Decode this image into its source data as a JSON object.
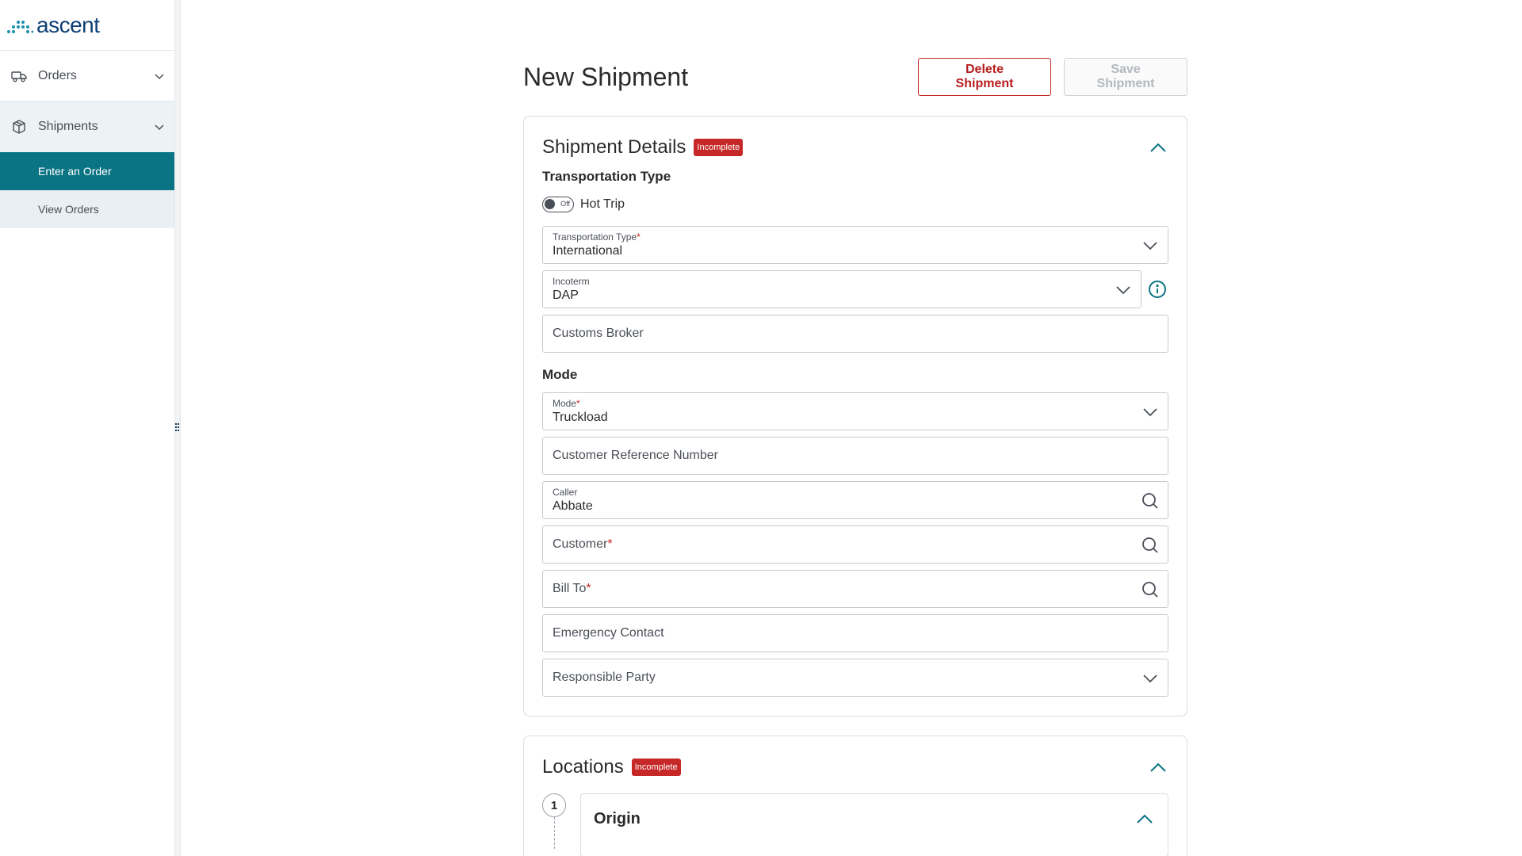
{
  "brand": {
    "name": "ascent"
  },
  "sidebar": {
    "items": [
      {
        "label": "Orders",
        "icon": "truck-icon",
        "expanded": false
      },
      {
        "label": "Shipments",
        "icon": "package-icon",
        "expanded": true
      }
    ],
    "subitems": [
      {
        "label": "Enter an Order",
        "active": true
      },
      {
        "label": "View Orders",
        "active": false
      }
    ]
  },
  "header": {
    "title": "New Shipment",
    "delete_label": "Delete Shipment",
    "save_label": "Save Shipment"
  },
  "shipment_details": {
    "title": "Shipment Details",
    "badge": "Incomplete",
    "transport_section": "Transportation Type",
    "hot_trip": {
      "label": "Hot Trip",
      "state": "Off"
    },
    "transportation_type": {
      "label": "Transportation Type",
      "value": "International"
    },
    "incoterm": {
      "label": "Incoterm",
      "value": "DAP"
    },
    "customs_broker": {
      "placeholder": "Customs Broker"
    },
    "mode_section": "Mode",
    "mode": {
      "label": "Mode",
      "value": "Truckload"
    },
    "customer_reference": {
      "placeholder": "Customer Reference Number"
    },
    "caller": {
      "label": "Caller",
      "value": "Abbate"
    },
    "customer": {
      "placeholder": "Customer"
    },
    "bill_to": {
      "placeholder": "Bill To"
    },
    "emergency_contact": {
      "placeholder": "Emergency Contact"
    },
    "responsible_party": {
      "placeholder": "Responsible Party"
    },
    "required_marker": "*"
  },
  "locations": {
    "title": "Locations",
    "badge": "Incomplete",
    "step_number": "1",
    "origin_title": "Origin"
  },
  "colors": {
    "accent": "#0b7484",
    "brand": "#0d3f74",
    "danger": "#c62828"
  }
}
